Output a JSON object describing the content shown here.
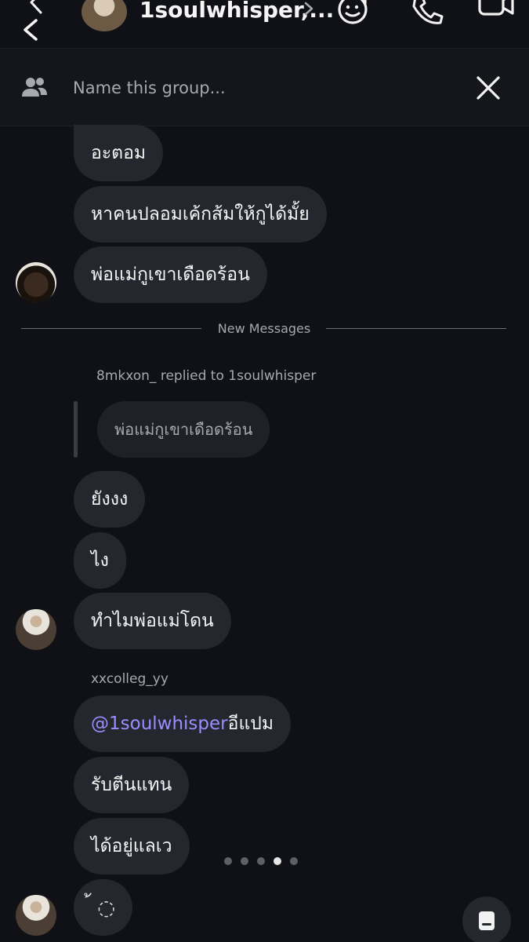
{
  "header": {
    "title": "1soulwhisper,...",
    "back_icon": "chevron-left-icon",
    "effects_icon": "face-plus-icon",
    "call_icon": "phone-icon",
    "video_icon": "video-camera-icon"
  },
  "group_name": {
    "placeholder": "Name this group...",
    "icon": "people-icon",
    "close_icon": "close-icon"
  },
  "divider": {
    "label": "New Messages"
  },
  "reply": {
    "meta": "8mkxon_ replied to 1soulwhisper",
    "quoted_text": "พ่อแม่กูเขาเดือดร้อน"
  },
  "sender_name": "xxcolleg_yy",
  "messages_group1": [
    "อะตอม",
    "หาคนปลอมเค้กส้มให้กูได้มั้ย",
    "พ่อแม่กูเขาเดือดร้อน"
  ],
  "messages_group2": [
    "ยังงง",
    "ไง",
    "ทำไมพ่อแม่โดน"
  ],
  "messages_group3": {
    "mention": "@1soulwhisper",
    "mention_rest": " อีแปม",
    "items": [
      "รับตีนแทน",
      "ได้อยู่แลเว",
      "้ ◌"
    ]
  },
  "pager": {
    "count": 5,
    "active_index": 3
  },
  "colors": {
    "background": "#0f1116",
    "bubble": "#25272e",
    "mention": "#9c8cff",
    "muted_text": "#a6a9b0"
  }
}
